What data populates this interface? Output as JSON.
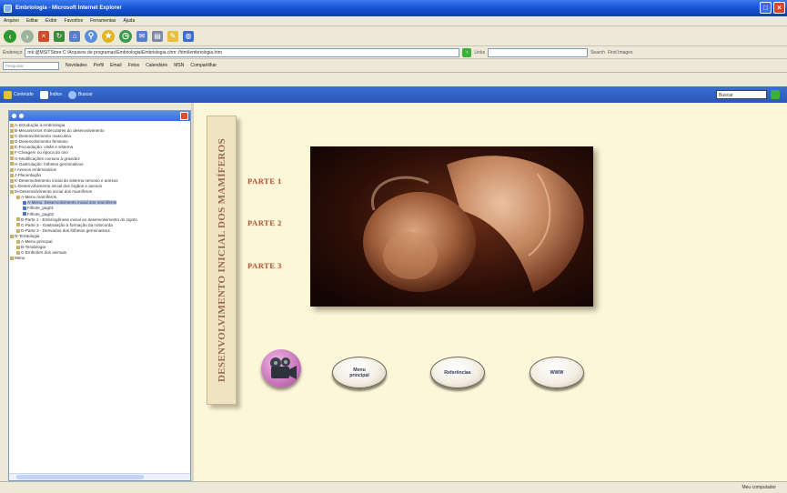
{
  "window": {
    "title": "Embriologia - Microsoft Internet Explorer"
  },
  "menu": [
    "Arquivo",
    "Editar",
    "Exibir",
    "Favoritos",
    "Ferramentas",
    "Ajuda"
  ],
  "address": {
    "label": "Endereço",
    "url": "mk:@MSITStore:C:\\Arquivos de programas\\Embriologia\\Embriologia.chm::/html/embriologia.htm",
    "links_label": "Links"
  },
  "links_bar": {
    "search_placeholder": "Pesquisar",
    "items": [
      "Novidades",
      "Perfil",
      "Email",
      "Fotos",
      "Calendário",
      "MSN",
      "Compartilhar"
    ],
    "right_items": [
      "Search",
      "Find Images"
    ]
  },
  "help_toolbar": {
    "buttons": [
      "Conteúdo",
      "Índice",
      "Buscar"
    ],
    "search_value": "Buscar"
  },
  "tree": {
    "items": [
      {
        "text": "A-Introdução à embriologia",
        "indent": 0,
        "icon": "book"
      },
      {
        "text": "B-Mecanismos moleculares do desenvolvimento",
        "indent": 0,
        "icon": "book"
      },
      {
        "text": "C-Desenvolvimento masculino",
        "indent": 0,
        "icon": "book"
      },
      {
        "text": "D-Desenvolvimento feminino",
        "indent": 0,
        "icon": "book"
      },
      {
        "text": "E-Fecundação: visão e sistema",
        "indent": 0,
        "icon": "book"
      },
      {
        "text": "F-Clivagem ou época do ovo",
        "indent": 0,
        "icon": "book"
      },
      {
        "text": "G-Modificações comuns à gravidez",
        "indent": 0,
        "icon": "book"
      },
      {
        "text": "H-Gastrulação: folhetos germinativos",
        "indent": 0,
        "icon": "book"
      },
      {
        "text": "I-Anexos embrionários",
        "indent": 0,
        "icon": "book"
      },
      {
        "text": "J-Placentação",
        "indent": 0,
        "icon": "book"
      },
      {
        "text": "K-Desenvolvimento inicial do sistema nervoso e anexos",
        "indent": 0,
        "icon": "book"
      },
      {
        "text": "L-Desenvolvimento inicial dos órgãos e anexos",
        "indent": 0,
        "icon": "book"
      },
      {
        "text": "M-Desenvolvimento inicial dos mamíferos",
        "indent": 0,
        "icon": "book"
      },
      {
        "text": "A-Menu mamíferos",
        "indent": 1,
        "icon": "book"
      },
      {
        "text": "A-Menu: Desenvolvimento inicial dos mamíferos",
        "indent": 2,
        "icon": "page",
        "selected": true
      },
      {
        "text": "Filhote_pag01",
        "indent": 2,
        "icon": "page"
      },
      {
        "text": "Filhote_pag02",
        "indent": 2,
        "icon": "page"
      },
      {
        "text": "B-Parte 1 - Embriogênese inicial ao desenvolvimento do zigoto",
        "indent": 1,
        "icon": "book"
      },
      {
        "text": "C-Parte 2 - Gastrulação à formação da notocorda",
        "indent": 1,
        "icon": "book"
      },
      {
        "text": "D-Parte 3 - Derivados dos folhetos germinativos",
        "indent": 1,
        "icon": "book"
      },
      {
        "text": "N-Teratologia",
        "indent": 0,
        "icon": "book"
      },
      {
        "text": "A-Menu principal",
        "indent": 1,
        "icon": "book"
      },
      {
        "text": "B-Teratologia",
        "indent": 1,
        "icon": "book"
      },
      {
        "text": "C-Embriões dos animais",
        "indent": 1,
        "icon": "book"
      },
      {
        "text": "Menu",
        "indent": 0,
        "icon": "book"
      }
    ]
  },
  "content": {
    "banner_title": "DESENVOLVIMENTO INICIAL DOS MAMÍFEROS",
    "parts": [
      "PARTE 1",
      "PARTE 2",
      "PARTE 3"
    ],
    "buttons": {
      "menu_principal": "Menu principal",
      "referencias": "Referências",
      "www": "WWW"
    }
  },
  "status": {
    "zone": "Meu computador"
  },
  "colors": {
    "xp_blue": "#1450d0",
    "content_bg": "#fbf7d8",
    "parte_link": "#b35a3a",
    "banner_text": "#9a6a4e"
  }
}
